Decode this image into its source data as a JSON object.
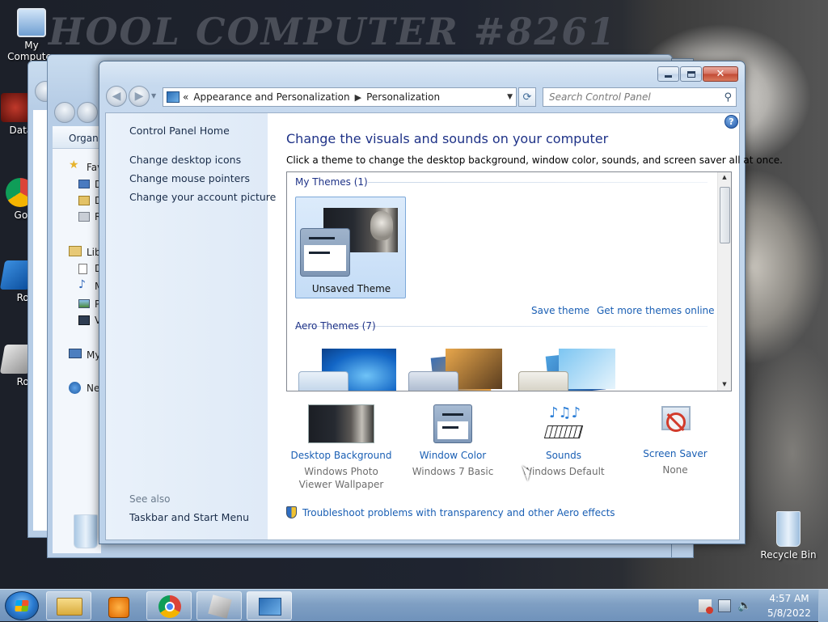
{
  "desktop": {
    "wallpaper_text": "HOOL COMPUTER #8261",
    "icons": [
      {
        "label": "My Computer"
      },
      {
        "label": "DataW"
      },
      {
        "label": "Go Ch"
      },
      {
        "label": "Roblo"
      },
      {
        "label": "Roblo"
      },
      {
        "label": "Recycle Bin"
      }
    ]
  },
  "background_window": {
    "organize_label": "Organiz",
    "favorites_label": "Fav",
    "libraries_label": "Lib",
    "computer_label": "My",
    "network_label": "Ne",
    "item_d1": "D",
    "item_d2": "D",
    "item_r": "R",
    "item_lib_d": "D",
    "item_m": "M",
    "item_p": "P",
    "item_v": "V"
  },
  "window": {
    "breadcrumb_prefix": "«",
    "breadcrumb": [
      "Appearance and Personalization",
      "Personalization"
    ],
    "search_placeholder": "Search Control Panel",
    "help_glyph": "?"
  },
  "left_pane": {
    "home": "Control Panel Home",
    "links": [
      "Change desktop icons",
      "Change mouse pointers",
      "Change your account picture"
    ],
    "see_also_heading": "See also",
    "see_also": [
      "Taskbar and Start Menu"
    ]
  },
  "main": {
    "title": "Change the visuals and sounds on your computer",
    "subtitle": "Click a theme to change the desktop background, window color, sounds, and screen saver all at once.",
    "my_themes_header": "My Themes (1)",
    "my_theme_name": "Unsaved Theme",
    "save_theme": "Save theme",
    "get_more": "Get more themes online",
    "aero_header": "Aero Themes (7)",
    "bottom_items": [
      {
        "label": "Desktop Background",
        "sub": "Windows Photo Viewer Wallpaper"
      },
      {
        "label": "Window Color",
        "sub": "Windows 7 Basic"
      },
      {
        "label": "Sounds",
        "sub": "Windows Default"
      },
      {
        "label": "Screen Saver",
        "sub": "None"
      }
    ],
    "troubleshoot": "Troubleshoot problems with transparency and other Aero effects"
  },
  "taskbar": {
    "time": "4:57 AM",
    "date": "5/8/2022"
  },
  "colors": {
    "link": "#1a5fb4",
    "heading": "#1e3287",
    "taskbar": "#7f9fc3"
  }
}
